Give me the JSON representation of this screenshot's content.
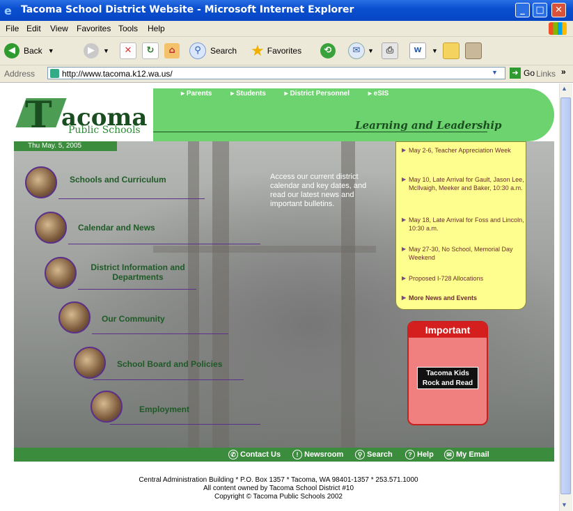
{
  "window": {
    "title": "Tacoma School District Website - Microsoft Internet Explorer"
  },
  "menu": [
    "File",
    "Edit",
    "View",
    "Favorites",
    "Tools",
    "Help"
  ],
  "toolbar": {
    "back": "Back",
    "search": "Search",
    "favorites": "Favorites"
  },
  "address": {
    "label": "Address",
    "url": "http://www.tacoma.k12.wa.us/",
    "go": "Go",
    "links": "Links"
  },
  "site": {
    "toplinks": [
      "Parents",
      "Students",
      "District Personnel",
      "eSIS"
    ],
    "logo_big": "T",
    "logo_rest": "acoma",
    "logo_sub": "Public Schools",
    "tagline": "Learning and Leadership",
    "date": "Thu May. 5, 2005",
    "nav": [
      {
        "label": "Schools and Curriculum"
      },
      {
        "label": "Calendar and News"
      },
      {
        "label": "District Information and Departments"
      },
      {
        "label": "Our Community"
      },
      {
        "label": "School Board and Policies"
      },
      {
        "label": "Employment"
      }
    ],
    "access_text": "Access our current district calendar and key dates, and read our latest news and important bulletins.",
    "news": [
      "May 2-6, Teacher Appreciation Week",
      "May 10, Late Arrival for Gault, Jason Lee, McIlvaigh, Meeker and Baker, 10:30 a.m.",
      "May 18, Late Arrival for Foss and Lincoln, 10:30 a.m.",
      "May 27-30, No School, Memorial Day Weekend",
      "Proposed I-728 Allocations",
      "More News and Events"
    ],
    "important": {
      "title": "Important",
      "button_line1": "Tacoma Kids",
      "button_line2": "Rock and Read"
    },
    "footer_links": [
      "Contact Us",
      "Newsroom",
      "Search",
      "Help",
      "My Email"
    ],
    "address_lines": [
      "Central Administration Building * P.O. Box 1357 * Tacoma, WA 98401-1357 * 253.571.1000",
      "All content owned by Tacoma School District #10",
      "Copyright © Tacoma Public Schools 2002"
    ]
  }
}
